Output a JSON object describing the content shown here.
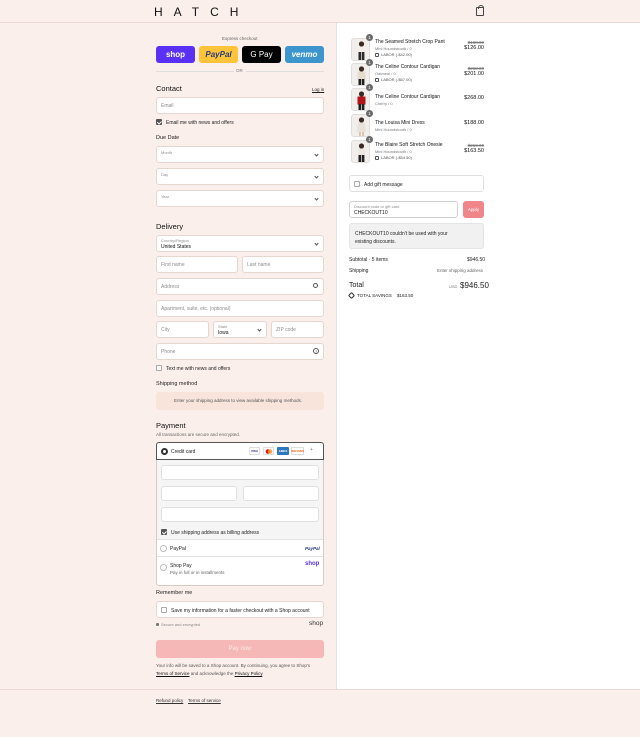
{
  "header": {
    "logo": "HATCH",
    "cart_icon": "shopping-bag-icon"
  },
  "express": {
    "label": "Express checkout",
    "buttons": [
      {
        "label": "shop",
        "bg": "#5a31f4",
        "color": "#ffffff"
      },
      {
        "label": "PayPal",
        "bg": "#ffc439",
        "color": "#253b80"
      },
      {
        "label": "G Pay",
        "bg": "#000000",
        "color": "#ffffff"
      },
      {
        "label": "venmo",
        "bg": "#3d95ce",
        "color": "#ffffff"
      }
    ],
    "or": "OR"
  },
  "contact": {
    "title": "Contact",
    "login": "Log in",
    "email_placeholder": "Email",
    "news_label": "Email me with news and offers"
  },
  "due": {
    "title": "Due Date",
    "month": "Month",
    "day": "Day",
    "year": "Year"
  },
  "delivery": {
    "title": "Delivery",
    "country_label": "Country/Region",
    "country_value": "United States",
    "first_name": "First name",
    "last_name": "Last name",
    "address": "Address",
    "apartment": "Apartment, suite, etc. (optional)",
    "city": "City",
    "state_label": "State",
    "state_value": "Iowa",
    "zip": "ZIP code",
    "phone": "Phone",
    "text_label": "Text me with news and offers"
  },
  "shipping": {
    "title": "Shipping method",
    "message": "Enter your shipping address to view available shipping methods."
  },
  "payment": {
    "title": "Payment",
    "subtitle": "All transactions are secure and encrypted.",
    "credit_card": "Credit card",
    "card_logos": [
      "VISA",
      "MC",
      "AMEX",
      "DISCOVER"
    ],
    "billing_label": "Use shipping address as billing address",
    "paypal": "PayPal",
    "paypal_logo": "PayPal",
    "shoppay": "Shop Pay",
    "shoppay_sub": "Pay in full or in installments",
    "shoppay_logo": "shop"
  },
  "remember": {
    "title": "Remember me",
    "label": "Save my information for a faster checkout with a Shop account",
    "secure": "Secure and encrypted",
    "shop_logo": "shop"
  },
  "pay_now": "Pay now",
  "legal": {
    "line1": "Your info will be saved to a Shop account. By continuing, you agree to Shop’s",
    "terms": "Terms of Service",
    "mid": "and acknowledge the",
    "privacy": "Privacy Policy",
    "end": "."
  },
  "footer": {
    "refund": "Refund policy",
    "terms": "Terms of service"
  },
  "cart": {
    "items": [
      {
        "qty": "1",
        "name": "The Seamed Stretch Crop Pant",
        "variant": "Mini Houndstooth / 0",
        "discount": "LABOR (-$42.00)",
        "old_price": "$168.00",
        "price": "$126.00"
      },
      {
        "qty": "1",
        "name": "The Celine Contour Cardigan",
        "variant": "Oatmeal / 0",
        "discount": "LABOR (-$67.00)",
        "old_price": "$268.00",
        "price": "$201.00"
      },
      {
        "qty": "1",
        "name": "The Celine Contour Cardigan",
        "variant": "Cherry / 0",
        "discount": "",
        "old_price": "",
        "price": "$268.00"
      },
      {
        "qty": "1",
        "name": "The Louisa Mini Dress",
        "variant": "Mini Houndstooth / 0",
        "discount": "",
        "old_price": "",
        "price": "$188.00"
      },
      {
        "qty": "1",
        "name": "The Blaire Soft Stretch Onesie",
        "variant": "Mini Houndstooth / 0",
        "discount": "LABOR (-$54.50)",
        "old_price": "$218.00",
        "price": "$163.50"
      }
    ],
    "gift_message": "Add gift message",
    "discount_label": "Discount code or gift card",
    "discount_value": "CHECKOUT10",
    "apply": "Apply",
    "error": "CHECKOUT10 couldn't be used with your existing discounts.",
    "subtotal_label": "Subtotal · 5 items",
    "subtotal": "$946.50",
    "shipping_label": "Shipping",
    "shipping_value": "Enter shipping address",
    "total_label": "Total",
    "currency": "USD",
    "total": "$946.50",
    "savings_label": "TOTAL SAVINGS",
    "savings": "$163.50"
  }
}
